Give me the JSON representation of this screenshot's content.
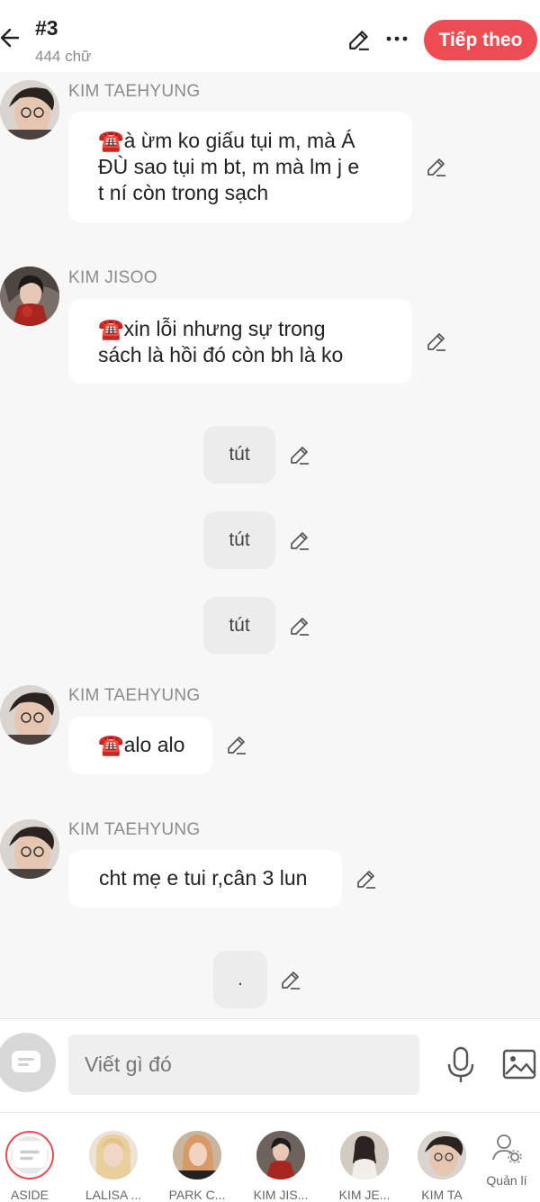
{
  "header": {
    "title": "#3",
    "word_count": "444 chữ",
    "next_label": "Tiếp theo"
  },
  "messages": [
    {
      "sender": "KIM TAEHYUNG",
      "lines": [
        "☎️à ừm ko giấu tụi m, mà Á",
        "ĐÙ sao tụi m bt, m mà lm j e",
        "t ní còn trong sạch"
      ]
    },
    {
      "sender": "KIM JISOO",
      "lines": [
        "☎️xin lỗi nhưng sự trong",
        "sách là hồi đó còn bh là ko"
      ]
    },
    {
      "text": "tút"
    },
    {
      "text": "tút"
    },
    {
      "text": "tút"
    },
    {
      "sender": "KIM TAEHYUNG",
      "lines": [
        "☎️alo alo"
      ]
    },
    {
      "sender": "KIM TAEHYUNG",
      "lines": [
        "cht mẹ e tui r,cân 3 lun"
      ]
    },
    {
      "text": "."
    }
  ],
  "composer": {
    "placeholder": "Viết gì đó"
  },
  "characters": [
    {
      "name": "ASIDE"
    },
    {
      "name": "LALISA ..."
    },
    {
      "name": "PARK C..."
    },
    {
      "name": "KIM JIS..."
    },
    {
      "name": "KIM JE..."
    },
    {
      "name": "KIM TA"
    }
  ],
  "manage_label": "Quản lí",
  "colors": {
    "accent": "#ee4c53",
    "bubble": "#ffffff",
    "narration": "#ececec",
    "background": "#f7f7f7"
  },
  "icons": [
    "back-arrow-icon",
    "pencil-icon",
    "more-icon",
    "mic-icon",
    "image-icon",
    "chat-bubble-icon",
    "manage-user-icon"
  ]
}
